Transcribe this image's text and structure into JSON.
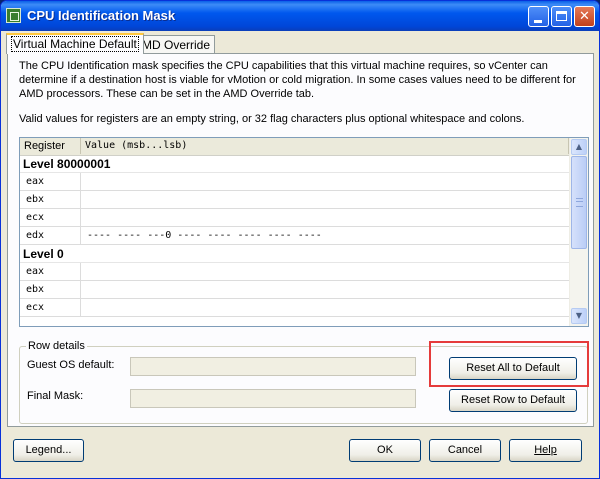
{
  "window": {
    "title": "CPU Identification Mask"
  },
  "tabs": [
    "Virtual Machine Default",
    "AMD Override"
  ],
  "description": "The CPU Identification mask specifies the CPU capabilities that this virtual machine requires, so vCenter can determine if a destination host is viable for vMotion or cold migration. In some cases values need to be different for AMD processors. These can be set in the AMD Override tab.",
  "valid_values": "Valid values for registers are an empty string, or 32 flag characters plus optional whitespace and colons.",
  "grid": {
    "columns": [
      "Register",
      "Value (msb...lsb)"
    ],
    "groups": [
      {
        "level": "Level 80000001",
        "rows": [
          {
            "register": "eax",
            "value": ""
          },
          {
            "register": "ebx",
            "value": ""
          },
          {
            "register": "ecx",
            "value": ""
          },
          {
            "register": "edx",
            "value": "---- ---- ---0 ---- ---- ---- ---- ----"
          }
        ]
      },
      {
        "level": "Level 0",
        "rows": [
          {
            "register": "eax",
            "value": ""
          },
          {
            "register": "ebx",
            "value": ""
          },
          {
            "register": "ecx",
            "value": ""
          }
        ]
      }
    ]
  },
  "row_details": {
    "legend": "Row details",
    "guest_os_label": "Guest OS default:",
    "guest_os_value": "",
    "final_mask_label": "Final Mask:",
    "final_mask_value": ""
  },
  "buttons": {
    "reset_all": "Reset All to Default",
    "reset_row": "Reset Row to Default",
    "legend": "Legend...",
    "ok": "OK",
    "cancel": "Cancel",
    "help": "Help"
  },
  "colors": {
    "title_bar": "#0058ee",
    "dialog_bg": "#ece9d8",
    "highlight_box": "#e53b3b"
  },
  "icons": {
    "app": "vmware-icon",
    "minimize": "minimize-icon",
    "maximize": "maximize-icon",
    "close": "close-icon"
  }
}
